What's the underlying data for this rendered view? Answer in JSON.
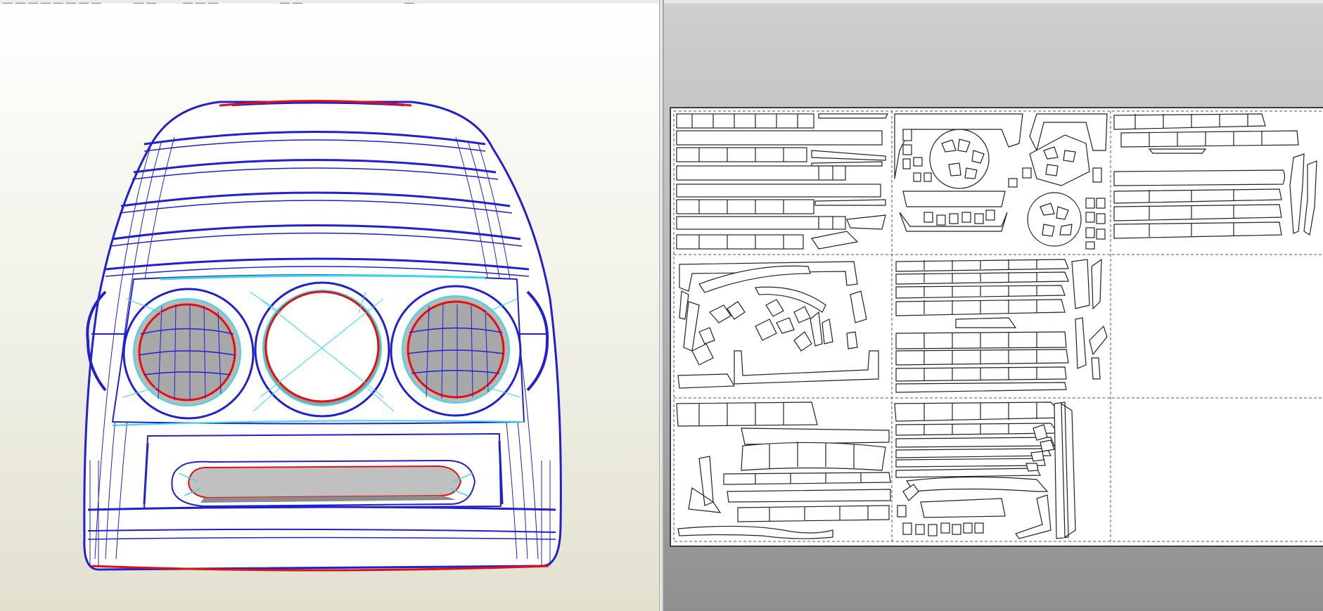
{
  "app": {
    "panes": [
      "3d-view",
      "2d-unfold-view"
    ]
  },
  "colors": {
    "mesh_edge": "#2020d0",
    "fold_edge": "#38d8e8",
    "cut_edge": "#e01010",
    "surface_shade": "#b8b8b8",
    "view3d_bg_top": "#ffffff",
    "view3d_bg_bottom": "#e2e1d0",
    "view2d_bg": "#b5b5b5",
    "paper": "#ffffff",
    "part_outline": "#222222"
  },
  "layout": {
    "sheets_cols": 3,
    "sheets_rows": 3,
    "empty_sheets": [
      "row2-col3",
      "row3-col3"
    ]
  }
}
